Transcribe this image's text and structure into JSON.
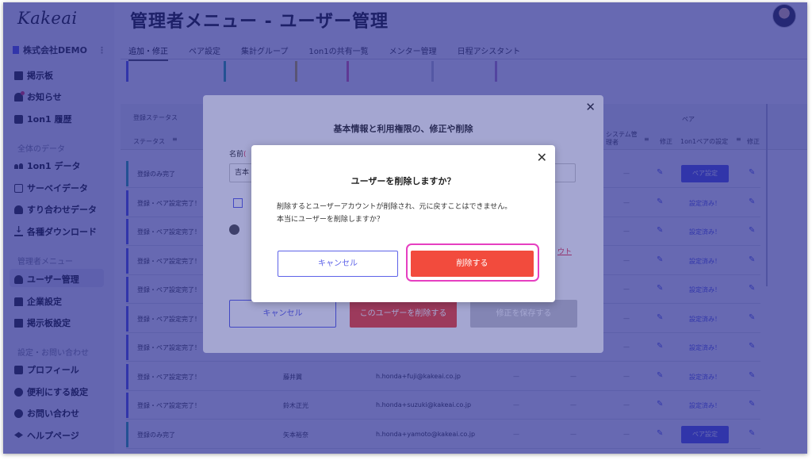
{
  "app": {
    "logo": "Kakeai",
    "page_title": "管理者メニュー - ユーザー管理"
  },
  "sidebar": {
    "company": "株式会社DEMO",
    "items_top": [
      {
        "label": "掲示板",
        "icon": "bulletin-board-icon"
      },
      {
        "label": "お知らせ",
        "icon": "bell-icon"
      },
      {
        "label": "1on1 履歴",
        "icon": "history-icon"
      }
    ],
    "section_data": "全体のデータ",
    "items_data": [
      {
        "label": "1on1 データ",
        "icon": "users-icon"
      },
      {
        "label": "サーベイデータ",
        "icon": "survey-icon"
      },
      {
        "label": "すり合わせデータ",
        "icon": "handshake-icon"
      },
      {
        "label": "各種ダウンロード",
        "icon": "download-icon"
      }
    ],
    "section_admin": "管理者メニュー",
    "items_admin": [
      {
        "label": "ユーザー管理",
        "icon": "user-manage-icon",
        "active": true
      },
      {
        "label": "企業設定",
        "icon": "company-icon"
      },
      {
        "label": "掲示板設定",
        "icon": "bulletin-settings-icon"
      }
    ],
    "section_settings": "設定・お問い合わせ",
    "items_settings": [
      {
        "label": "プロフィール",
        "icon": "profile-icon"
      },
      {
        "label": "便利にする設定",
        "icon": "gear-icon"
      },
      {
        "label": "お問い合わせ",
        "icon": "help-icon"
      },
      {
        "label": "ヘルプページ",
        "icon": "graduation-cap-icon"
      }
    ]
  },
  "tabs": [
    "追加・修正",
    "ペア設定",
    "集計グループ",
    "1on1の共有一覧",
    "メンター管理",
    "日程アシスタント"
  ],
  "table": {
    "headers": {
      "reg_status": "登録ステータス",
      "status": "ステータス",
      "system_admin": "システム管理者",
      "edit": "修正",
      "pair": "ペア",
      "pair_setting": "1on1ペアの設定",
      "edit2": "修正"
    },
    "rows": [
      {
        "status": "登録のみ完了",
        "name": "",
        "email": "",
        "pair": "ペア設定",
        "pair_type": "button"
      },
      {
        "status": "登録・ペア設定完了！",
        "name": "",
        "email": "",
        "pair": "設定済み！",
        "pair_type": "text"
      },
      {
        "status": "登録・ペア設定完了！",
        "name": "",
        "email": "",
        "pair": "設定済み！",
        "pair_type": "text"
      },
      {
        "status": "登録・ペア設定完了！",
        "name": "",
        "email": "",
        "pair": "設定済み！",
        "pair_type": "text"
      },
      {
        "status": "登録・ペア設定完了！",
        "name": "",
        "email": "",
        "pair": "設定済み！",
        "pair_type": "text"
      },
      {
        "status": "登録・ペア設定完了！",
        "name": "",
        "email": "",
        "pair": "設定済み！",
        "pair_type": "text"
      },
      {
        "status": "登録・ペア設定完了！",
        "name": "",
        "email": "",
        "pair": "設定済み！",
        "pair_type": "text"
      },
      {
        "status": "登録・ペア設定完了！",
        "name": "藤井翼",
        "email": "h.honda+fuji@kakeai.co.jp",
        "pair": "設定済み！",
        "pair_type": "text"
      },
      {
        "status": "登録・ペア設定完了！",
        "name": "鈴木正光",
        "email": "h.honda+suzuki@kakeai.co.jp",
        "pair": "設定済み！",
        "pair_type": "text"
      },
      {
        "status": "登録のみ完了",
        "name": "矢本裕奈",
        "email": "h.honda+yamoto@kakeai.co.jp",
        "pair": "ペア設定",
        "pair_type": "button"
      }
    ],
    "dash": "—"
  },
  "edit_modal": {
    "title": "基本情報と利用権限の、修正や削除",
    "name_label": "名前",
    "name_value": "吉本",
    "link_fragment": "ウト",
    "cancel": "キャンセル",
    "delete": "このユーザーを削除する",
    "save": "修正を保存する"
  },
  "confirm_modal": {
    "title": "ユーザーを削除しますか？",
    "body_line1": "削除するとユーザーアカウントが削除され、元に戻すことはできません。",
    "body_line2": "本当にユーザーを削除しますか？",
    "cancel": "キャンセル",
    "confirm": "削除する"
  },
  "colors": {
    "accent": "#5d62e8",
    "danger": "#f24b3d",
    "highlight_ring": "#e63fc1",
    "overlay": "#1c208c"
  }
}
